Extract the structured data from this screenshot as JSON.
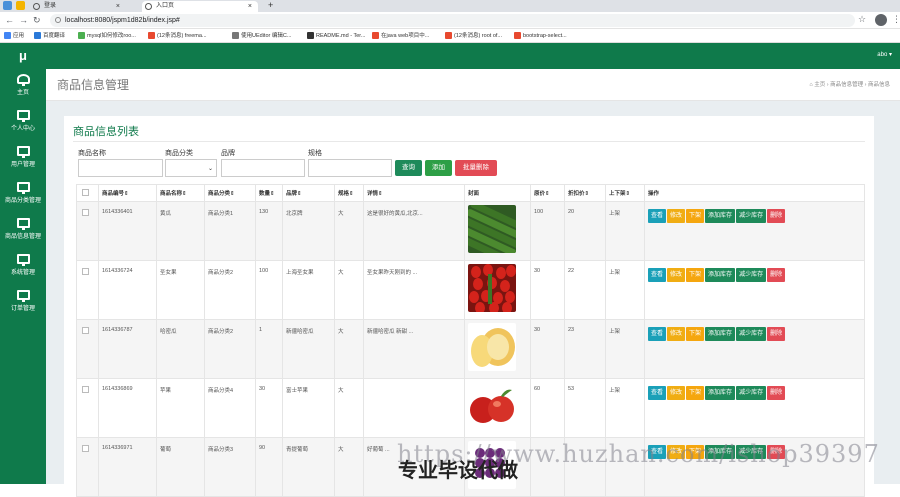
{
  "browser": {
    "tabs": [
      {
        "title": "登录"
      },
      {
        "title": "入口页"
      }
    ],
    "url": "localhost:8080/jspm1d82b/index.jsp#",
    "bookmarks": [
      {
        "label": "应用",
        "color": "#4285f4"
      },
      {
        "label": "百度翻译",
        "color": "#2a79d8"
      },
      {
        "label": "mysql如何修改roo...",
        "color": "#4caf50"
      },
      {
        "label": "(12条消息) freema...",
        "color": "#e8492f"
      },
      {
        "label": "使用UEditor 编辑C...",
        "color": "#777777"
      },
      {
        "label": "README.md - Ter...",
        "color": "#333333"
      },
      {
        "label": "在java web项目中...",
        "color": "#e8492f"
      },
      {
        "label": "(12条消息) root of...",
        "color": "#e8492f"
      },
      {
        "label": "bootstrap-select...",
        "color": "#e8492f"
      }
    ]
  },
  "app": {
    "logo": "μ",
    "user": "abo ▾",
    "sidebar": [
      {
        "label": "主页",
        "icon": "dashboard-icon"
      },
      {
        "label": "个人中心",
        "icon": "monitor-icon"
      },
      {
        "label": "用户管理",
        "icon": "monitor-icon"
      },
      {
        "label": "商品分类管理",
        "icon": "monitor-icon"
      },
      {
        "label": "商品信息管理",
        "icon": "monitor-icon"
      },
      {
        "label": "系统管理",
        "icon": "monitor-icon"
      },
      {
        "label": "订单管理",
        "icon": "monitor-icon"
      }
    ],
    "page_title": "商品信息管理",
    "breadcrumb": "⌂ 主页 › 商品信息管理 › 商品信息"
  },
  "panel": {
    "title": "商品信息列表",
    "filters": [
      {
        "label": "商品名称",
        "value": ""
      },
      {
        "label": "商品分类",
        "value": ""
      },
      {
        "label": "品牌",
        "value": ""
      },
      {
        "label": "规格",
        "value": ""
      }
    ],
    "buttons": {
      "search": "查询",
      "add": "添加",
      "batch_delete": "批量删除"
    },
    "columns": [
      "",
      "商品编号⇕",
      "商品名称⇕",
      "商品分类⇕",
      "数量⇕",
      "品牌⇕",
      "规格⇕",
      "详情⇕",
      "封面",
      "原价⇕",
      "折扣价⇕",
      "上下架⇕",
      "操作"
    ],
    "row_actions": [
      "查看",
      "修改",
      "下架",
      "添加库存",
      "减少库存",
      "删除"
    ],
    "rows": [
      {
        "id": "1614336401",
        "name": "黄瓜",
        "category": "商品分类1",
        "qty": "130",
        "brand": "北京牌",
        "spec": "大",
        "detail": "这是很好的黄瓜,北京...",
        "price": "100",
        "discount": "20",
        "status": "上架",
        "cover": "cucumber"
      },
      {
        "id": "1614336724",
        "name": "圣女果",
        "category": "商品分类2",
        "qty": "100",
        "brand": "上海圣女果",
        "spec": "大",
        "detail": "圣女果昨天刚到的 ...",
        "price": "30",
        "discount": "22",
        "status": "上架",
        "cover": "tomato"
      },
      {
        "id": "1614336787",
        "name": "哈密瓜",
        "category": "商品分类2",
        "qty": "1",
        "brand": "新疆哈密瓜",
        "spec": "大",
        "detail": "新疆哈密瓜 新甜 ...",
        "price": "30",
        "discount": "23",
        "status": "上架",
        "cover": "melon"
      },
      {
        "id": "1614336869",
        "name": "苹果",
        "category": "商品分类4",
        "qty": "30",
        "brand": "富士苹果",
        "spec": "大",
        "detail": "",
        "price": "60",
        "discount": "53",
        "status": "上架",
        "cover": "apple"
      },
      {
        "id": "1614336971",
        "name": "葡萄",
        "category": "商品分类3",
        "qty": "90",
        "brand": "青提葡萄",
        "spec": "大",
        "detail": "好葡萄 ...",
        "price": "",
        "discount": "",
        "status": "",
        "cover": "grape"
      }
    ]
  },
  "watermark": {
    "line1": "https://www.huzhan.com/ishop39397",
    "line2": "专业毕设代做"
  },
  "colors": {
    "green": "#0f7a4b",
    "view": "#1aa0b8",
    "edit": "#f0ad13",
    "off": "#f5a60e",
    "stock": "#1e8a5a",
    "delete": "#e24b55",
    "search": "#1e8a5a",
    "add": "#2d9f46",
    "batch": "#e24b55"
  }
}
